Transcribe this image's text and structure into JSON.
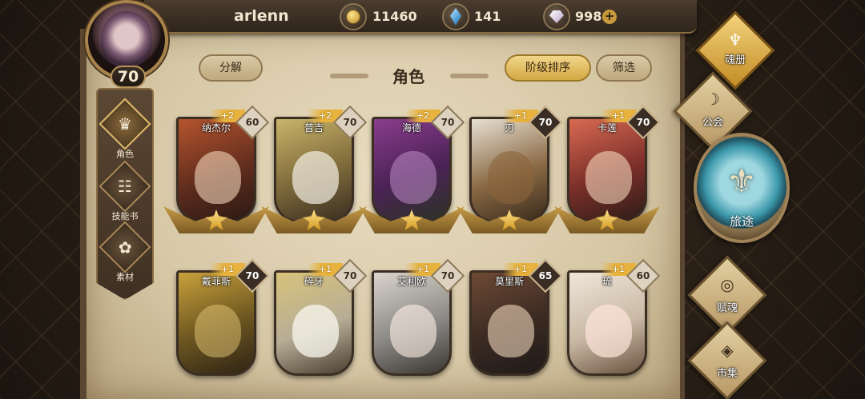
{
  "header": {
    "username": "arlenn",
    "gold": "11460",
    "crystal": "141",
    "gem": "998",
    "plus": "+"
  },
  "player": {
    "level": "70"
  },
  "sidebar": {
    "items": [
      {
        "label": "角色",
        "glyph": "♛",
        "icon": "character-icon",
        "active": true
      },
      {
        "label": "技能书",
        "glyph": "☷",
        "icon": "skillbook-icon",
        "active": false
      },
      {
        "label": "素材",
        "glyph": "✿",
        "icon": "materials-icon",
        "active": false
      }
    ]
  },
  "toolbar": {
    "disassemble": "分解",
    "title": "角色",
    "sort_by_tier": "阶级排序",
    "filter": "筛选"
  },
  "heroes": [
    {
      "name": "纳杰尔",
      "plus": "+2",
      "level": "60",
      "badge": "light"
    },
    {
      "name": "普吉",
      "plus": "+2",
      "level": "70",
      "badge": "light"
    },
    {
      "name": "海德",
      "plus": "+2",
      "level": "70",
      "badge": "light"
    },
    {
      "name": "刃",
      "plus": "+1",
      "level": "70",
      "badge": "dark"
    },
    {
      "name": "卡莲",
      "plus": "+1",
      "level": "70",
      "badge": "dark"
    },
    {
      "name": "戴菲斯",
      "plus": "+1",
      "level": "70",
      "badge": "dark"
    },
    {
      "name": "碎牙",
      "plus": "+1",
      "level": "70",
      "badge": "dark"
    },
    {
      "name": "艾利欧",
      "plus": "+1",
      "level": "70",
      "badge": "dark"
    },
    {
      "name": "莫里斯",
      "plus": "+1",
      "level": "65",
      "badge": "dark"
    },
    {
      "name": "琉",
      "plus": "+1",
      "level": "60",
      "badge": "light"
    }
  ],
  "right_nav": {
    "soul_book": "魂册",
    "guild": "公会",
    "journey": "旅途",
    "soul_gift": "赋魂",
    "market": "市集"
  },
  "colors": {
    "accent_gold": "#e7b23d",
    "parchment": "#e8dcc0",
    "frame_brown": "#5a4631"
  }
}
